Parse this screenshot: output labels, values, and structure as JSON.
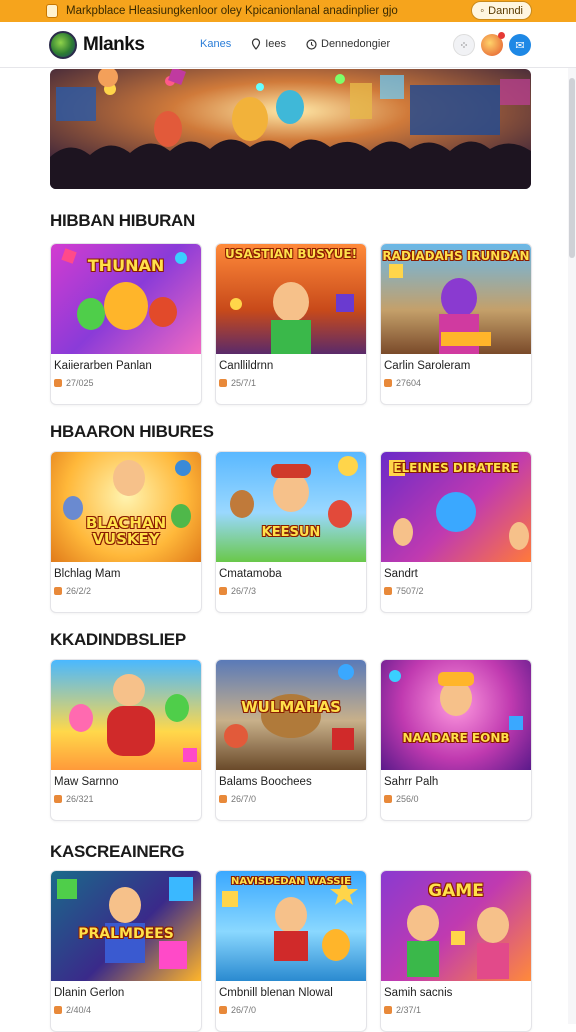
{
  "banner": {
    "text": "Markpblace Hleasiungkenloor oley Kpicanionlanal anadinplier gjo",
    "button": "Danndi"
  },
  "header": {
    "logo": "Mlanks",
    "nav": [
      {
        "label": "Kanes",
        "icon": "home-icon",
        "active": true
      },
      {
        "label": "Iees",
        "icon": "pin-icon",
        "active": false
      },
      {
        "label": "Dennedongier",
        "icon": "clock-icon",
        "active": false
      }
    ]
  },
  "sections": [
    {
      "title": "HIBBAN HIBURAN",
      "cards": [
        {
          "title": "Kaiierarben Panlan",
          "meta": "27/025",
          "art": "THUNAN",
          "theme": "pink"
        },
        {
          "title": "Canllildrnn",
          "meta": "25/7/1",
          "art": "USASTIAN BUSYUE!",
          "theme": "orange"
        },
        {
          "title": "Carlin Saroleram",
          "meta": "27604",
          "art": "RADIADAHS IRUNDAN",
          "theme": "purple"
        }
      ]
    },
    {
      "title": "HBAARON HIBURES",
      "cards": [
        {
          "title": "Blchlag Mam",
          "meta": "26/2/2",
          "art": "BLACHAN VUSKEY",
          "theme": "yellow"
        },
        {
          "title": "Cmatamoba",
          "meta": "26/7/3",
          "art": "KEESUN",
          "theme": "green"
        },
        {
          "title": "Sandrt",
          "meta": "7507/2",
          "art": "ELEINES DIBATERE",
          "theme": "violet"
        }
      ]
    },
    {
      "title": "KKADINDBSLIEP",
      "cards": [
        {
          "title": "Maw Sarnno",
          "meta": "26/321",
          "art": "",
          "theme": "sunny"
        },
        {
          "title": "Balams Boochees",
          "meta": "26/7/0",
          "art": "WULMAHAS",
          "theme": "stadium"
        },
        {
          "title": "Sahrr Palh",
          "meta": "256/0",
          "art": "NAADARE EONB",
          "theme": "magenta"
        }
      ]
    },
    {
      "title": "KASCREAINERG",
      "cards": [
        {
          "title": "Dlanin Gerlon",
          "meta": "2/40/4",
          "art": "PRALMDEES",
          "theme": "teal"
        },
        {
          "title": "Cmbnill blenan Nlowal",
          "meta": "26/7/0",
          "art": "NAVISDEDAN WASSIE",
          "theme": "sky"
        },
        {
          "title": "Samih sacnis",
          "meta": "2/37/1",
          "art": "GAME",
          "theme": "party"
        }
      ]
    }
  ],
  "colors": {
    "banner": "#f6a41c",
    "accent": "#2a7dd8",
    "card_border": "#e4e4e8"
  }
}
